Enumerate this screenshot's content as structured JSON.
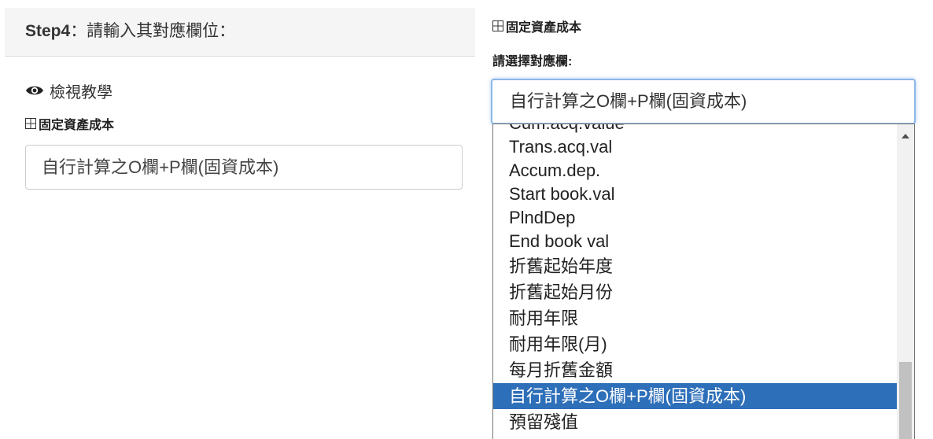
{
  "left": {
    "step_heading_strong": "Step4",
    "step_heading_rest": "：請輸入其對應欄位：",
    "view_tutorial_label": "檢視教學",
    "field_label": "固定資產成本",
    "field_value": "自行計算之O欄+P欄(固資成本)"
  },
  "right": {
    "field_label": "固定資產成本",
    "select_prompt": "請選擇對應欄:",
    "selected_value": "自行計算之O欄+P欄(固資成本)",
    "options": [
      "Cum.acq.value",
      "Trans.acq.val",
      "Accum.dep.",
      "Start book.val",
      "PlndDep",
      "End book val",
      "折舊起始年度",
      "折舊起始月份",
      "耐用年限",
      "耐用年限(月)",
      "每月折舊金額",
      "自行計算之O欄+P欄(固資成本)",
      "預留殘值"
    ],
    "selected_index": 11
  },
  "icons": {
    "eye": "eye-icon",
    "table": "table-icon",
    "scroll_up": "chevron-up-icon"
  },
  "colors": {
    "header_bg": "#f5f5f5",
    "focus_border": "#8db7e8",
    "selected_option_bg": "#2e6fb9",
    "scroll_thumb": "#c1c1c1"
  }
}
